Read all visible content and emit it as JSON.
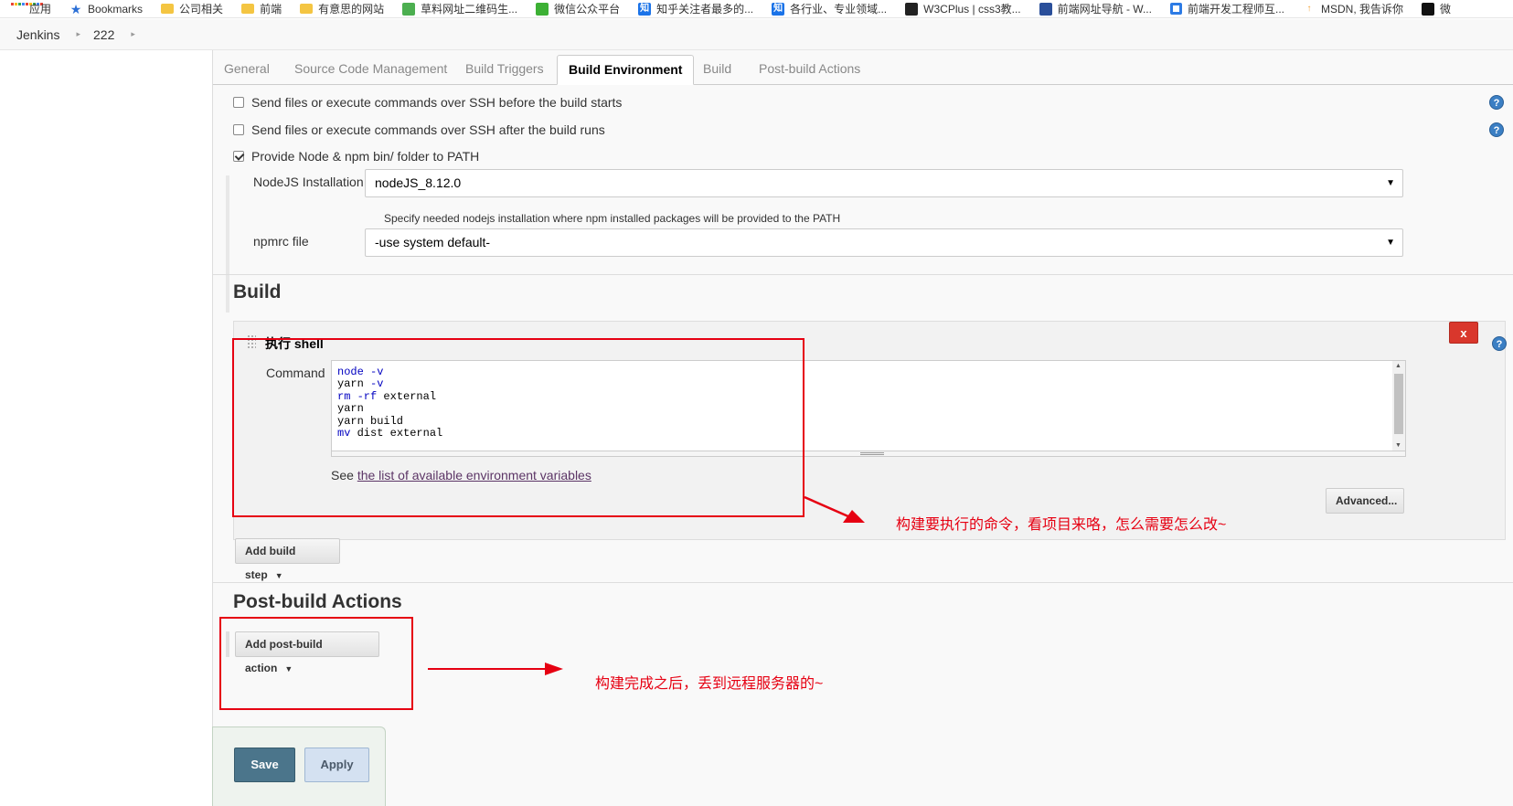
{
  "bookmarks_bar": {
    "items": [
      {
        "label": "应用",
        "icon": "apps-grid-icon"
      },
      {
        "label": "Bookmarks",
        "icon": "star-icon"
      },
      {
        "label": "公司相关",
        "icon": "folder-icon"
      },
      {
        "label": "前端",
        "icon": "folder-icon"
      },
      {
        "label": "有意思的网站",
        "icon": "folder-icon"
      },
      {
        "label": "草料网址二维码生...",
        "icon": "qr-icon"
      },
      {
        "label": "微信公众平台",
        "icon": "wechat-icon"
      },
      {
        "label": "知乎关注者最多的...",
        "icon": "zhihu-icon"
      },
      {
        "label": "各行业、专业领域...",
        "icon": "zhihu-icon"
      },
      {
        "label": "W3CPlus | css3教...",
        "icon": "w3cplus-icon"
      },
      {
        "label": "前端网址导航 - W...",
        "icon": "grid-icon"
      },
      {
        "label": "前端开发工程师互...",
        "icon": "ring-icon"
      },
      {
        "label": "MSDN, 我告诉你",
        "icon": "msdn-icon"
      },
      {
        "label": "微",
        "icon": "github-icon"
      }
    ]
  },
  "breadcrumb": {
    "items": [
      "Jenkins",
      "222"
    ]
  },
  "tabs": [
    {
      "label": "General",
      "active": false
    },
    {
      "label": "Source Code Management",
      "active": false
    },
    {
      "label": "Build Triggers",
      "active": false
    },
    {
      "label": "Build Environment",
      "active": true
    },
    {
      "label": "Build",
      "active": false
    },
    {
      "label": "Post-build Actions",
      "active": false
    }
  ],
  "build_environment": {
    "options": [
      {
        "label": "Send files or execute commands over SSH before the build starts",
        "checked": false,
        "has_help": true
      },
      {
        "label": "Send files or execute commands over SSH after the build runs",
        "checked": false,
        "has_help": true
      },
      {
        "label": "Provide Node & npm bin/ folder to PATH",
        "checked": true,
        "has_help": false
      }
    ],
    "nodejs": {
      "label": "NodeJS Installation",
      "value": "nodeJS_8.12.0",
      "hint": "Specify needed nodejs installation where npm installed packages will be provided to the PATH"
    },
    "npmrc": {
      "label": "npmrc file",
      "value": "-use system default-"
    }
  },
  "build": {
    "title": "Build",
    "step": {
      "title": "执行 shell",
      "delete_label": "x",
      "command_label": "Command",
      "command_lines": [
        {
          "text": "node -v",
          "type": "kw"
        },
        {
          "text": "yarn -v",
          "type": "mixed"
        },
        {
          "text": "rm -rf external",
          "type": "mixed"
        },
        {
          "text": "yarn",
          "type": "plain"
        },
        {
          "text": "yarn build",
          "type": "plain"
        },
        {
          "text": "mv dist external",
          "type": "mixed"
        }
      ],
      "env_prefix": "See ",
      "env_link": "the list of available environment variables",
      "advanced_label": "Advanced..."
    },
    "add_step_label": "Add build step"
  },
  "post_build": {
    "title": "Post-build Actions",
    "add_action_label": "Add post-build action"
  },
  "actions": {
    "save_label": "Save",
    "apply_label": "Apply"
  },
  "annotations": {
    "build_note": "构建要执行的命令，看项目来咯，怎么需要怎么改~",
    "post_note": "构建完成之后，丢到远程服务器的~",
    "color": "#e60012"
  },
  "colors": {
    "save_button": "#4b758b",
    "apply_button": "#d4e1f1",
    "delete_button": "#d9372c",
    "help_icon": "#3b7fc4",
    "link": "#5c3566"
  }
}
